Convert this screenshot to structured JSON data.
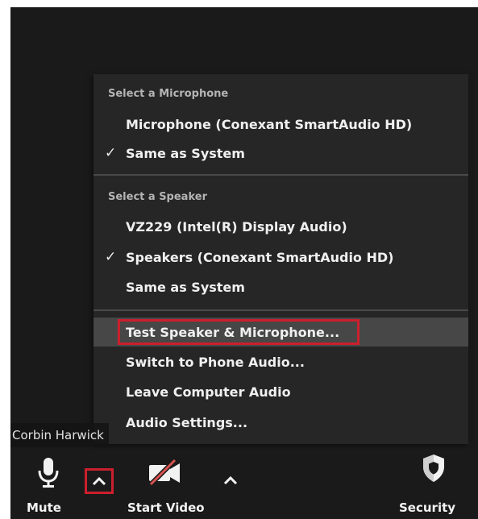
{
  "audio_menu": {
    "microphone_section": {
      "header": "Select a Microphone",
      "items": [
        {
          "label": "Microphone (Conexant SmartAudio HD)",
          "checked": false
        },
        {
          "label": "Same as System",
          "checked": true
        }
      ]
    },
    "speaker_section": {
      "header": "Select a Speaker",
      "items": [
        {
          "label": "VZ229 (Intel(R) Display Audio)",
          "checked": false
        },
        {
          "label": "Speakers (Conexant SmartAudio HD)",
          "checked": true
        },
        {
          "label": "Same as System",
          "checked": false
        }
      ]
    },
    "actions": [
      {
        "label": "Test Speaker & Microphone...",
        "highlighted": true
      },
      {
        "label": "Switch to Phone Audio..."
      },
      {
        "label": "Leave Computer Audio"
      },
      {
        "label": "Audio Settings..."
      }
    ],
    "checkmark": "✓"
  },
  "participant": {
    "name": "Corbin Harwick"
  },
  "toolbar": {
    "mute": {
      "label": "Mute",
      "icon": "microphone-icon"
    },
    "audio_options": {
      "icon": "caret-up-icon"
    },
    "start_video": {
      "label": "Start Video",
      "icon": "video-off-icon"
    },
    "video_options": {
      "icon": "caret-up-icon"
    },
    "security": {
      "label": "Security",
      "icon": "shield-icon"
    }
  },
  "colors": {
    "background": "#1a1a1a",
    "menu_background": "#262626",
    "hover_background": "#474747",
    "highlight_red": "#cc1f2d",
    "video_off_slash": "#d9534f"
  }
}
